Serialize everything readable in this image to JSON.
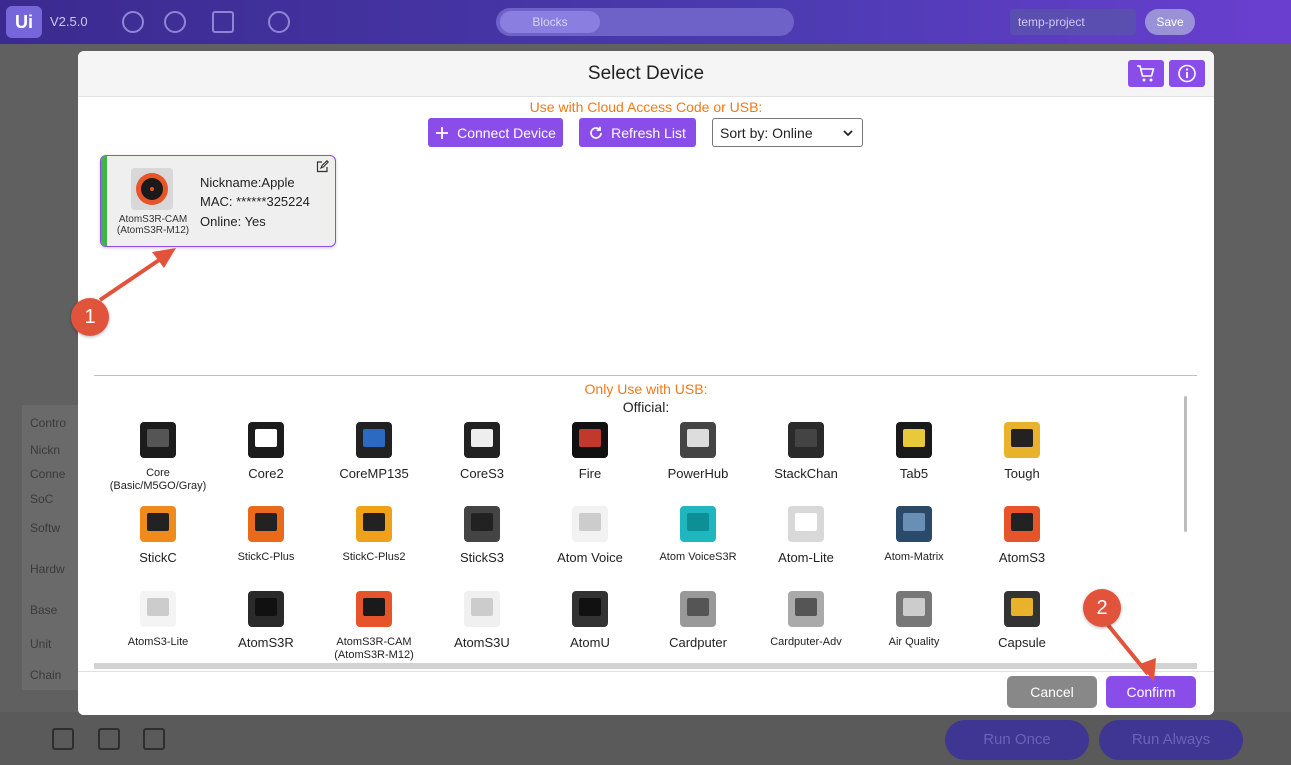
{
  "app": {
    "logo": "Ui",
    "version": "V2.5.0",
    "tab_blocks": "Blocks",
    "project_name": "temp-project",
    "save_label": "Save",
    "side_labels": [
      "Contro",
      "Nickn",
      "Conne",
      "SoC",
      "Softw",
      "Hardw",
      "Base",
      "Unit",
      "Chain"
    ],
    "run_once": "Run Once",
    "run_always": "Run Always"
  },
  "modal": {
    "title": "Select Device",
    "cart_icon": "cart-icon",
    "info_icon": "info-icon",
    "cloud_label": "Use with Cloud Access Code or USB:",
    "connect_label": "Connect Device",
    "refresh_label": "Refresh List",
    "sort_label": "Sort by: Online",
    "device_card": {
      "model_line1": "AtomS3R-CAM",
      "model_line2": "(AtomS3R-M12)",
      "nickname": "Nickname:Apple",
      "mac": "MAC: ******325224",
      "online": "Online: Yes",
      "status_color": "#3db34a"
    },
    "usb_label": "Only Use with USB:",
    "official_label": "Official:",
    "devices": [
      {
        "name": "Core",
        "sub": "(Basic/M5GO/Gray)"
      },
      {
        "name": "Core2",
        "sub": ""
      },
      {
        "name": "CoreMP135",
        "sub": ""
      },
      {
        "name": "CoreS3",
        "sub": ""
      },
      {
        "name": "Fire",
        "sub": ""
      },
      {
        "name": "PowerHub",
        "sub": ""
      },
      {
        "name": "StackChan",
        "sub": ""
      },
      {
        "name": "Tab5",
        "sub": ""
      },
      {
        "name": "Tough",
        "sub": ""
      },
      {
        "name": "StickC",
        "sub": ""
      },
      {
        "name": "StickC-Plus",
        "sub": ""
      },
      {
        "name": "StickC-Plus2",
        "sub": ""
      },
      {
        "name": "StickS3",
        "sub": ""
      },
      {
        "name": "Atom Voice",
        "sub": ""
      },
      {
        "name": "Atom VoiceS3R",
        "sub": ""
      },
      {
        "name": "Atom-Lite",
        "sub": ""
      },
      {
        "name": "Atom-Matrix",
        "sub": ""
      },
      {
        "name": "AtomS3",
        "sub": ""
      },
      {
        "name": "AtomS3-Lite",
        "sub": ""
      },
      {
        "name": "AtomS3R",
        "sub": ""
      },
      {
        "name": "AtomS3R-CAM",
        "sub": "(AtomS3R-M12)"
      },
      {
        "name": "AtomS3U",
        "sub": ""
      },
      {
        "name": "AtomU",
        "sub": ""
      },
      {
        "name": "Cardputer",
        "sub": ""
      },
      {
        "name": "Cardputer-Adv",
        "sub": ""
      },
      {
        "name": "Air Quality",
        "sub": ""
      },
      {
        "name": "Capsule",
        "sub": ""
      }
    ],
    "cancel_label": "Cancel",
    "confirm_label": "Confirm"
  },
  "annotations": {
    "step1": "1",
    "step2": "2",
    "color": "#e2533c"
  },
  "accent_color": "#8a4dea"
}
